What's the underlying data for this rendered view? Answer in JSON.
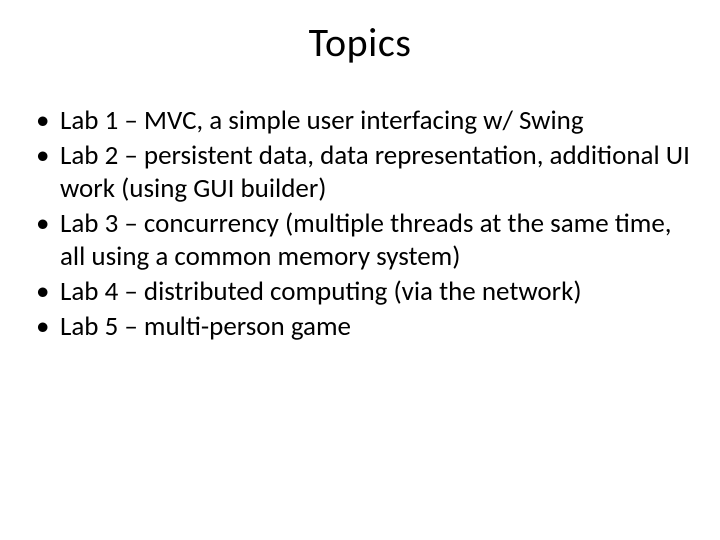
{
  "title": "Topics",
  "bullets": [
    "Lab 1 – MVC, a simple user interfacing w/ Swing",
    "Lab 2 – persistent data, data representation, additional UI work (using GUI builder)",
    "Lab 3 – concurrency (multiple threads at the same time, all using a common memory system)",
    "Lab 4 – distributed computing (via the network)",
    "Lab 5 – multi-person game"
  ]
}
